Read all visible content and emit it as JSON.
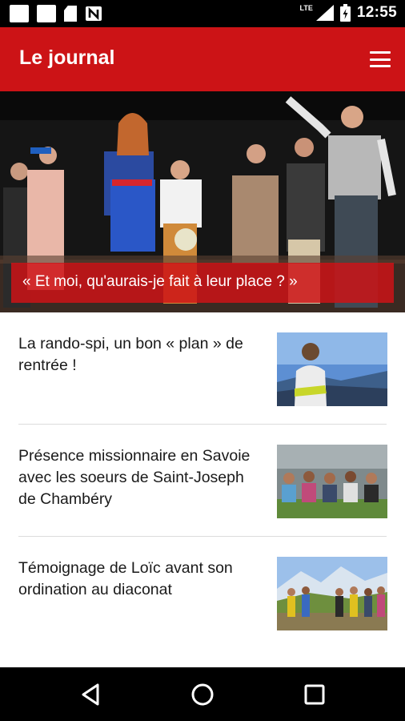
{
  "status_bar": {
    "network": "LTE",
    "time": "12:55"
  },
  "app_bar": {
    "title": "Le journal",
    "menu_icon": "hamburger-menu-icon"
  },
  "featured": {
    "caption": "« Et moi, qu'aurais-je fait à leur place ? »"
  },
  "articles": [
    {
      "title": "La rando-spi, un bon « plan » de rentrée !"
    },
    {
      "title": "Présence missionnaire en Savoie avec les soeurs de Saint-Joseph de Chambéry"
    },
    {
      "title": "Témoignage de Loïc avant son ordination au diaconat"
    }
  ],
  "nav_bar": {
    "back_icon": "back-triangle-icon",
    "home_icon": "home-circle-icon",
    "recents_icon": "recents-square-icon"
  },
  "colors": {
    "brand_red": "#cc1316"
  }
}
